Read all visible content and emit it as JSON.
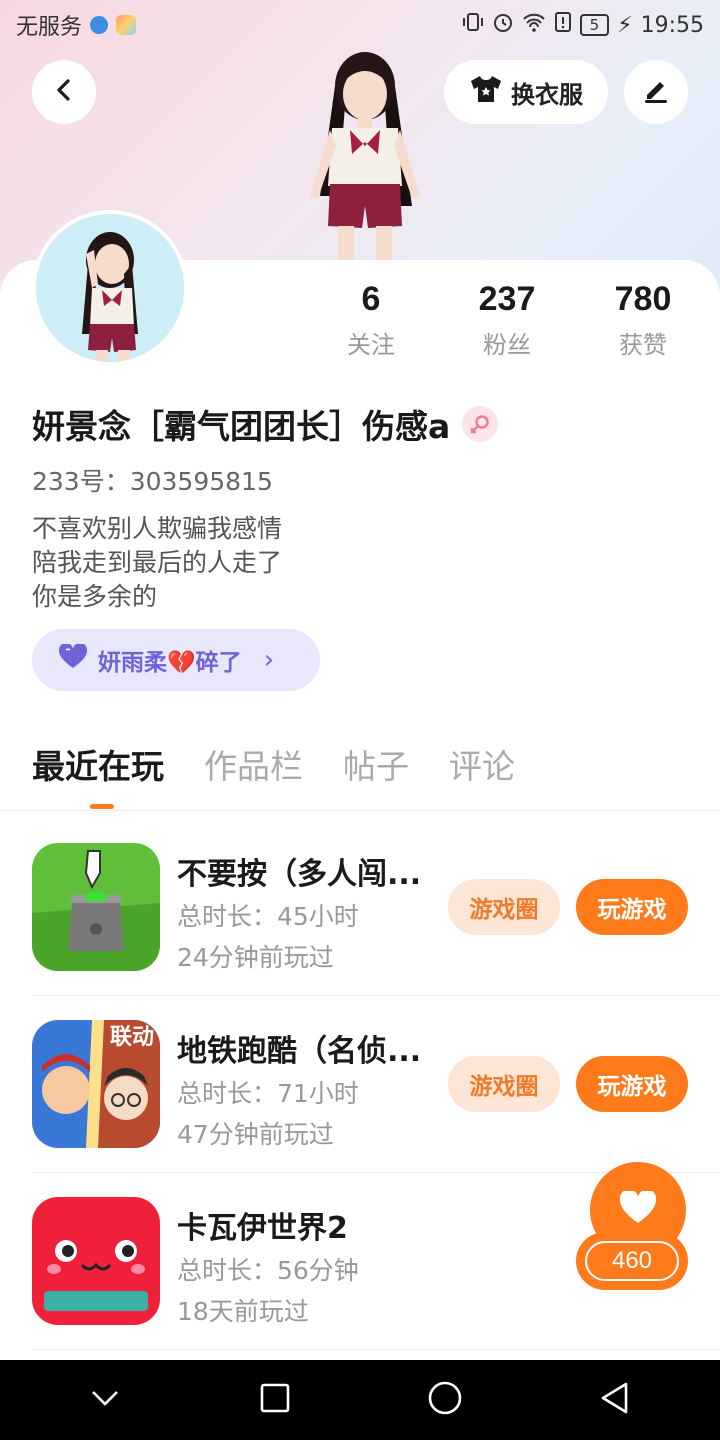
{
  "status_bar": {
    "carrier": "无服务",
    "battery": "5",
    "time": "19:55"
  },
  "header": {
    "outfit_label": "换衣服"
  },
  "stats": [
    {
      "value": "6",
      "label": "关注"
    },
    {
      "value": "237",
      "label": "粉丝"
    },
    {
      "value": "780",
      "label": "获赞"
    }
  ],
  "profile": {
    "nickname": "妍景念［霸气团团长］伤感a",
    "uid": "233号：303595815",
    "bio": [
      "不喜欢别人欺骗我感情",
      "陪我走到最后的人走了",
      "你是多余的"
    ],
    "relation": "妍雨柔💔碎了"
  },
  "tabs": [
    "最近在玩",
    "作品栏",
    "帖子",
    "评论"
  ],
  "games": [
    {
      "title": "不要按（多人闯...",
      "duration": "总时长：45小时",
      "last_played": "24分钟前玩过",
      "circle_label": "游戏圈",
      "play_label": "玩游戏"
    },
    {
      "title": "地铁跑酷（名侦...",
      "duration": "总时长：71小时",
      "last_played": "47分钟前玩过",
      "circle_label": "游戏圈",
      "play_label": "玩游戏"
    },
    {
      "title": "卡瓦伊世界2",
      "duration": "总时长：56分钟",
      "last_played": "18天前玩过"
    }
  ],
  "like": {
    "count": "460"
  },
  "colors": {
    "accent": "#ff7a1a",
    "accent_soft": "#fde6d6",
    "relation_bg": "#e9e8fa",
    "relation_text": "#6f63d8"
  }
}
